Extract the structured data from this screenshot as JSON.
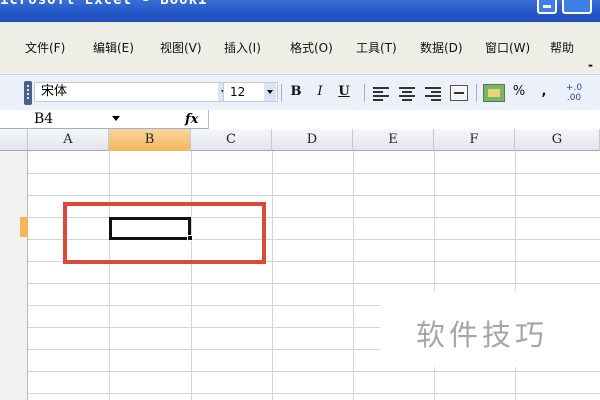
{
  "window": {
    "title": "icrosoft Excel - Book1"
  },
  "menu": {
    "items": [
      "文件(F)",
      "编辑(E)",
      "视图(V)",
      "插入(I)",
      "格式(O)",
      "工具(T)",
      "数据(D)",
      "窗口(W)",
      "帮助"
    ],
    "overflow": "-"
  },
  "toolbar": {
    "font_name": "宋体",
    "font_size": "12",
    "bold": "B",
    "italic": "I",
    "underline": "U",
    "percent": "%",
    "comma": ",",
    "increase_decimal": "+.0 .00"
  },
  "formula_bar": {
    "name_box": "B4",
    "fx": "fx",
    "formula": ""
  },
  "sheet": {
    "columns": [
      "A",
      "B",
      "C",
      "D",
      "E",
      "F",
      "G"
    ],
    "active_column": "B",
    "active_row": 4,
    "selected_cell": "B4"
  },
  "annotation": {
    "highlight_color": "#d94a3a"
  },
  "watermark": {
    "text": "软件技巧"
  }
}
